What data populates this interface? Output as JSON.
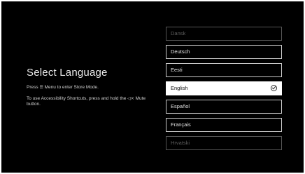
{
  "screen": {
    "title": "Select Language",
    "instructions": {
      "store_mode_prefix": "Press",
      "store_mode_icon": "menu-icon",
      "store_mode_glyph": "☰",
      "store_mode_suffix": "Menu to enter Store Mode.",
      "accessibility_prefix": "To use Accessibility Shortcuts, press and hold the",
      "accessibility_icon": "mute-icon",
      "accessibility_glyph": "◁×",
      "accessibility_suffix": "Mute button."
    }
  },
  "languages": {
    "items": [
      {
        "label": "Dansk",
        "state": "partial"
      },
      {
        "label": "Deutsch",
        "state": "normal"
      },
      {
        "label": "Eesti",
        "state": "normal"
      },
      {
        "label": "English",
        "state": "selected",
        "icon": "checkmark-circle-icon"
      },
      {
        "label": "Español",
        "state": "normal"
      },
      {
        "label": "Français",
        "state": "normal"
      },
      {
        "label": "Hrvatski",
        "state": "partial"
      }
    ],
    "selected": "English"
  },
  "colors": {
    "background": "#000000",
    "selected_background": "#ffffff",
    "item_border": "#c8c8c8",
    "text": "#e4e4e4"
  }
}
